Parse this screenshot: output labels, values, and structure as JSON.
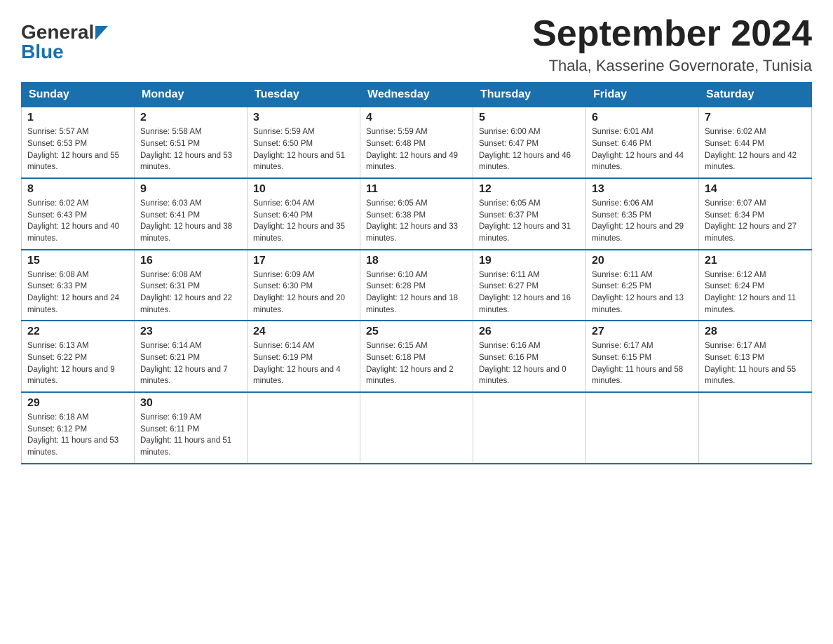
{
  "header": {
    "logo_general": "General",
    "logo_blue": "Blue",
    "title": "September 2024",
    "subtitle": "Thala, Kasserine Governorate, Tunisia"
  },
  "calendar": {
    "days_of_week": [
      "Sunday",
      "Monday",
      "Tuesday",
      "Wednesday",
      "Thursday",
      "Friday",
      "Saturday"
    ],
    "weeks": [
      [
        {
          "day": "1",
          "sunrise": "5:57 AM",
          "sunset": "6:53 PM",
          "daylight": "12 hours and 55 minutes."
        },
        {
          "day": "2",
          "sunrise": "5:58 AM",
          "sunset": "6:51 PM",
          "daylight": "12 hours and 53 minutes."
        },
        {
          "day": "3",
          "sunrise": "5:59 AM",
          "sunset": "6:50 PM",
          "daylight": "12 hours and 51 minutes."
        },
        {
          "day": "4",
          "sunrise": "5:59 AM",
          "sunset": "6:48 PM",
          "daylight": "12 hours and 49 minutes."
        },
        {
          "day": "5",
          "sunrise": "6:00 AM",
          "sunset": "6:47 PM",
          "daylight": "12 hours and 46 minutes."
        },
        {
          "day": "6",
          "sunrise": "6:01 AM",
          "sunset": "6:46 PM",
          "daylight": "12 hours and 44 minutes."
        },
        {
          "day": "7",
          "sunrise": "6:02 AM",
          "sunset": "6:44 PM",
          "daylight": "12 hours and 42 minutes."
        }
      ],
      [
        {
          "day": "8",
          "sunrise": "6:02 AM",
          "sunset": "6:43 PM",
          "daylight": "12 hours and 40 minutes."
        },
        {
          "day": "9",
          "sunrise": "6:03 AM",
          "sunset": "6:41 PM",
          "daylight": "12 hours and 38 minutes."
        },
        {
          "day": "10",
          "sunrise": "6:04 AM",
          "sunset": "6:40 PM",
          "daylight": "12 hours and 35 minutes."
        },
        {
          "day": "11",
          "sunrise": "6:05 AM",
          "sunset": "6:38 PM",
          "daylight": "12 hours and 33 minutes."
        },
        {
          "day": "12",
          "sunrise": "6:05 AM",
          "sunset": "6:37 PM",
          "daylight": "12 hours and 31 minutes."
        },
        {
          "day": "13",
          "sunrise": "6:06 AM",
          "sunset": "6:35 PM",
          "daylight": "12 hours and 29 minutes."
        },
        {
          "day": "14",
          "sunrise": "6:07 AM",
          "sunset": "6:34 PM",
          "daylight": "12 hours and 27 minutes."
        }
      ],
      [
        {
          "day": "15",
          "sunrise": "6:08 AM",
          "sunset": "6:33 PM",
          "daylight": "12 hours and 24 minutes."
        },
        {
          "day": "16",
          "sunrise": "6:08 AM",
          "sunset": "6:31 PM",
          "daylight": "12 hours and 22 minutes."
        },
        {
          "day": "17",
          "sunrise": "6:09 AM",
          "sunset": "6:30 PM",
          "daylight": "12 hours and 20 minutes."
        },
        {
          "day": "18",
          "sunrise": "6:10 AM",
          "sunset": "6:28 PM",
          "daylight": "12 hours and 18 minutes."
        },
        {
          "day": "19",
          "sunrise": "6:11 AM",
          "sunset": "6:27 PM",
          "daylight": "12 hours and 16 minutes."
        },
        {
          "day": "20",
          "sunrise": "6:11 AM",
          "sunset": "6:25 PM",
          "daylight": "12 hours and 13 minutes."
        },
        {
          "day": "21",
          "sunrise": "6:12 AM",
          "sunset": "6:24 PM",
          "daylight": "12 hours and 11 minutes."
        }
      ],
      [
        {
          "day": "22",
          "sunrise": "6:13 AM",
          "sunset": "6:22 PM",
          "daylight": "12 hours and 9 minutes."
        },
        {
          "day": "23",
          "sunrise": "6:14 AM",
          "sunset": "6:21 PM",
          "daylight": "12 hours and 7 minutes."
        },
        {
          "day": "24",
          "sunrise": "6:14 AM",
          "sunset": "6:19 PM",
          "daylight": "12 hours and 4 minutes."
        },
        {
          "day": "25",
          "sunrise": "6:15 AM",
          "sunset": "6:18 PM",
          "daylight": "12 hours and 2 minutes."
        },
        {
          "day": "26",
          "sunrise": "6:16 AM",
          "sunset": "6:16 PM",
          "daylight": "12 hours and 0 minutes."
        },
        {
          "day": "27",
          "sunrise": "6:17 AM",
          "sunset": "6:15 PM",
          "daylight": "11 hours and 58 minutes."
        },
        {
          "day": "28",
          "sunrise": "6:17 AM",
          "sunset": "6:13 PM",
          "daylight": "11 hours and 55 minutes."
        }
      ],
      [
        {
          "day": "29",
          "sunrise": "6:18 AM",
          "sunset": "6:12 PM",
          "daylight": "11 hours and 53 minutes."
        },
        {
          "day": "30",
          "sunrise": "6:19 AM",
          "sunset": "6:11 PM",
          "daylight": "11 hours and 51 minutes."
        },
        null,
        null,
        null,
        null,
        null
      ]
    ]
  }
}
